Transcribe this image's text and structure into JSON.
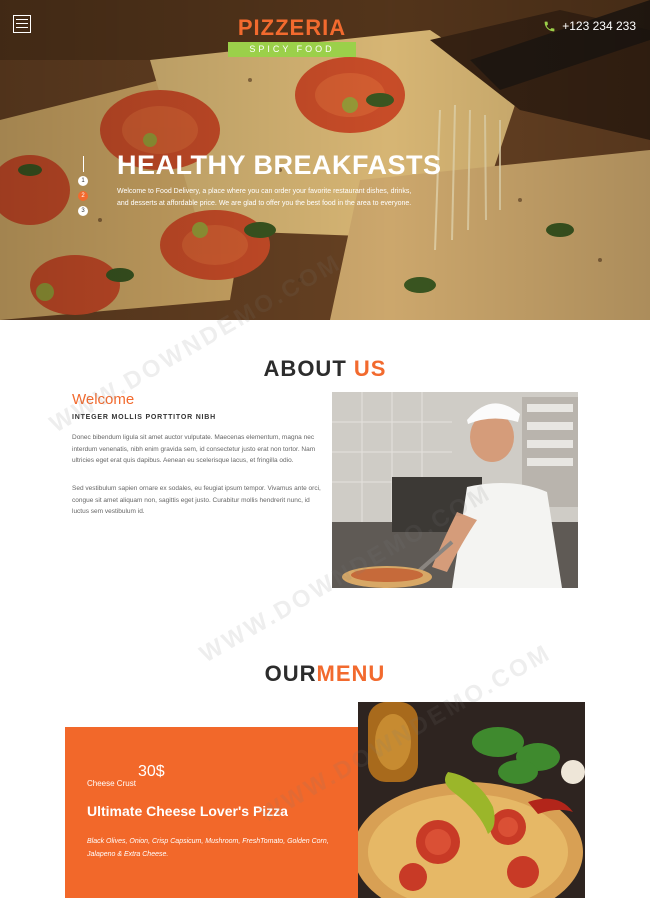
{
  "header": {
    "logo_title": "PIZZERIA",
    "logo_subtitle": "SPICY FOOD",
    "phone": "+123 234 233"
  },
  "hero": {
    "title": "HEALTHY BREAKFASTS",
    "text": "Welcome to Food Delivery, a place where you can order your favorite restaurant dishes, drinks, and desserts at affordable price. We are glad to offer you the best food in the area to everyone.",
    "dots": [
      "1",
      "2",
      "3"
    ],
    "active_dot": 2
  },
  "about": {
    "title_main": "ABOUT",
    "title_accent": "US",
    "welcome": "Welcome",
    "subtitle": "INTEGER MOLLIS PORTTITOR NIBH",
    "paragraph1": "Donec bibendum ligula sit amet auctor vulputate. Maecenas elementum, magna nec interdum venenatis, nibh enim gravida sem, id consectetur justo erat non tortor. Nam ultricies eget erat quis dapibus. Aenean eu scelerisque lacus, et fringilla odio.",
    "paragraph2": "Sed vestibulum sapien ornare ex sodales, eu feugiat ipsum tempor. Vivamus ante orci, congue sit amet aliquam non, sagittis eget justo. Curabitur mollis hendrerit nunc, id luctus sem vestibulum id."
  },
  "menu": {
    "title_main": "OUR",
    "title_accent": "MENU",
    "item": {
      "price_label": "Cheese Crust",
      "price": "30$",
      "name": "Ultimate Cheese Lover's Pizza",
      "description": "Black Olives, Onion, Crisp Capsicum, Mushroom, FreshTomato, Golden Corn, Jalapeno & Extra Cheese."
    }
  },
  "watermark": "WWW.DOWNDEMO.COM",
  "colors": {
    "accent": "#f26a2e",
    "logo_badge": "#9bd04a",
    "menu_card": "#f2682a"
  }
}
